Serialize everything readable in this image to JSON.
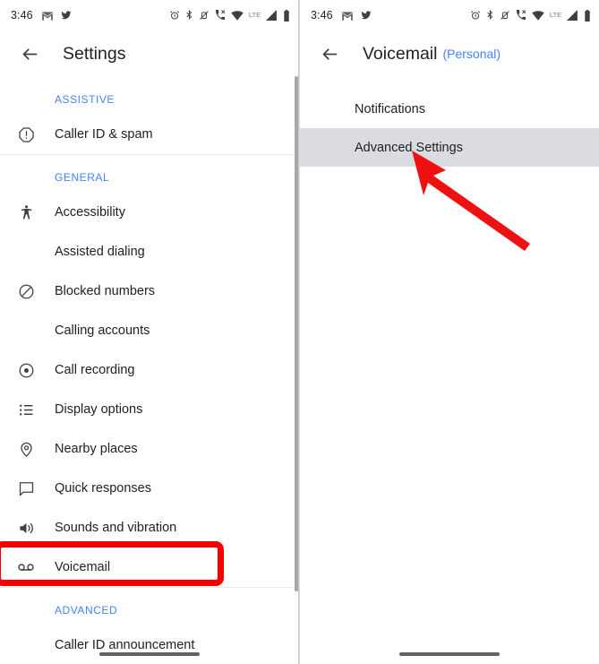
{
  "left_phone": {
    "status_bar": {
      "time": "3:46",
      "left_icons": [
        "gmail-icon",
        "twitter-icon"
      ],
      "right_icons": [
        "alarm-icon",
        "bluetooth-icon",
        "vibrate-off-icon",
        "call-signal-icon",
        "wifi-icon",
        "lte-label",
        "cellular-signal-icon",
        "battery-icon"
      ],
      "network_label": "LTE"
    },
    "appbar": {
      "back_icon": "back-arrow-icon",
      "title": "Settings"
    },
    "sections": [
      {
        "header": "ASSISTIVE",
        "items": [
          {
            "label": "Caller ID & spam",
            "icon": "warning-octagon-icon",
            "has_icon": true
          }
        ]
      },
      {
        "header": "GENERAL",
        "items": [
          {
            "label": "Accessibility",
            "icon": "accessibility-icon",
            "has_icon": true
          },
          {
            "label": "Assisted dialing",
            "icon": "",
            "has_icon": false
          },
          {
            "label": "Blocked numbers",
            "icon": "block-icon",
            "has_icon": true
          },
          {
            "label": "Calling accounts",
            "icon": "",
            "has_icon": false
          },
          {
            "label": "Call recording",
            "icon": "record-icon",
            "has_icon": true
          },
          {
            "label": "Display options",
            "icon": "list-icon",
            "has_icon": true
          },
          {
            "label": "Nearby places",
            "icon": "location-pin-icon",
            "has_icon": true
          },
          {
            "label": "Quick responses",
            "icon": "chat-bubble-icon",
            "has_icon": true
          },
          {
            "label": "Sounds and vibration",
            "icon": "volume-icon",
            "has_icon": true
          },
          {
            "label": "Voicemail",
            "icon": "voicemail-icon",
            "has_icon": true,
            "highlighted": true
          }
        ]
      },
      {
        "header": "ADVANCED",
        "items": [
          {
            "label": "Caller ID announcement",
            "icon": "",
            "has_icon": false
          }
        ]
      }
    ]
  },
  "right_phone": {
    "status_bar": {
      "time": "3:46",
      "network_label": "LTE"
    },
    "appbar": {
      "back_icon": "back-arrow-icon",
      "title": "Voicemail",
      "subtitle": "(Personal)"
    },
    "items": [
      {
        "label": "Notifications",
        "selected": false
      },
      {
        "label": "Advanced Settings",
        "selected": true
      }
    ]
  },
  "annotations": {
    "highlight_box_target": "Voicemail",
    "arrow_target": "Advanced Settings",
    "accent_red": "#f50000",
    "accent_blue": "#4285f4",
    "selected_row_bg": "#dadce0"
  }
}
